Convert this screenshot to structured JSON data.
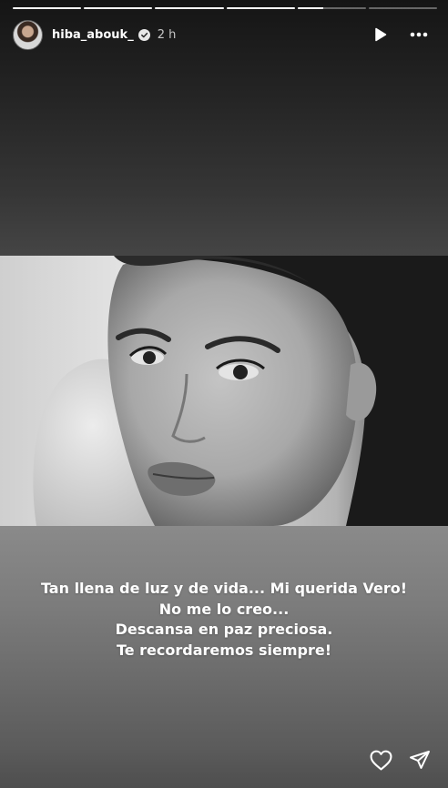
{
  "story": {
    "progress": [
      1,
      1,
      1,
      1,
      0.38,
      0
    ],
    "username": "hiba_abouk_",
    "time": "2 h",
    "verified": true
  },
  "caption": {
    "lines": [
      "Tan llena de luz y de vida... Mi querida Vero!",
      "No me lo creo...",
      "Descansa en paz preciosa.",
      "Te recordaremos siempre!"
    ]
  },
  "icons": {
    "avatar": "profile-photo",
    "verified": "verified-badge-icon",
    "play": "play-icon",
    "more": "more-horizontal-icon",
    "like": "heart-icon",
    "share": "paper-plane-icon",
    "photo": "black-and-white-portrait-photo"
  }
}
